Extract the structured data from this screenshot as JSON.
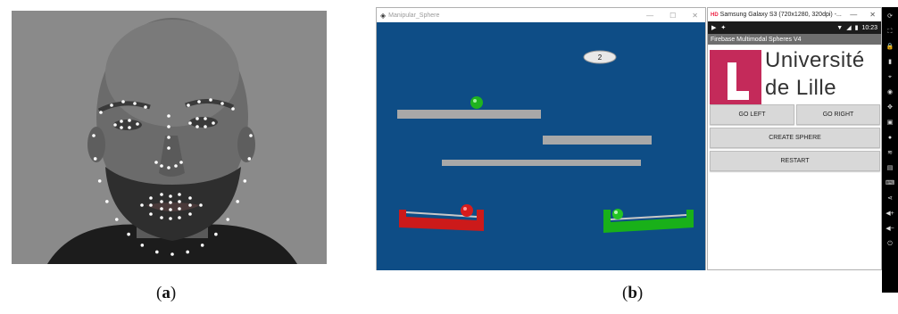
{
  "caption_a": {
    "open": "(",
    "letter": "a",
    "close": ")"
  },
  "caption_b": {
    "open": "(",
    "letter": "b",
    "close": ")"
  },
  "unity": {
    "title": "Manipular_Sphere",
    "score": "2"
  },
  "emulator": {
    "title": "Samsung Galaxy S3 (720x1280, 320dpi) -...",
    "status_time": "10:23",
    "app_title": "Firebase Multimodal Spheres V4",
    "university_line1": "Université",
    "university_line2": "de Lille",
    "buttons": {
      "go_left": "GO LEFT",
      "go_right": "GO RIGHT",
      "create_sphere": "CREATE SPHERE",
      "restart": "RESTART"
    }
  },
  "colors": {
    "game_background": "#0e4d86",
    "platform": "#a8a8a8",
    "red_basket": "#cc1a1a",
    "green_basket": "#19b019",
    "univ_magenta": "#c42a5a"
  }
}
